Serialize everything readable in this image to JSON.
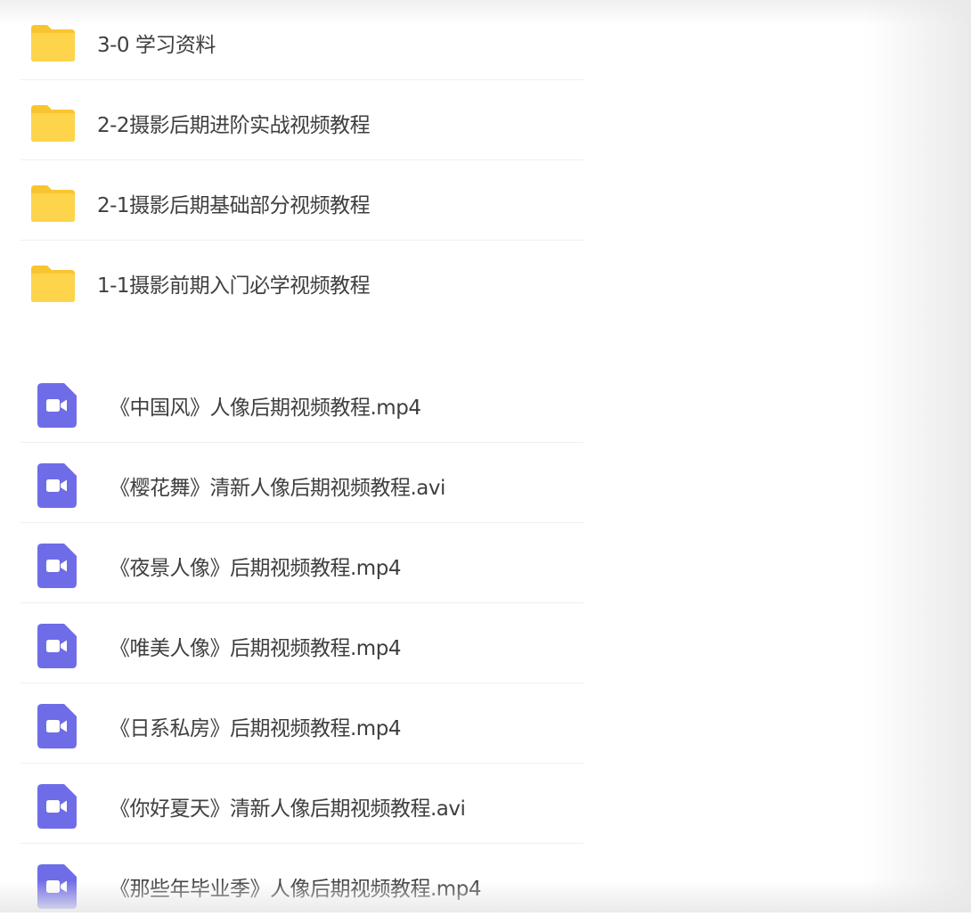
{
  "folders": [
    {
      "name": "3-0 学习资料",
      "icon": "folder-icon"
    },
    {
      "name": "2-2摄影后期进阶实战视频教程",
      "icon": "folder-icon"
    },
    {
      "name": "2-1摄影后期基础部分视频教程",
      "icon": "folder-icon"
    },
    {
      "name": "1-1摄影前期入门必学视频教程",
      "icon": "folder-icon"
    }
  ],
  "files": [
    {
      "name": "《中国风》人像后期视频教程.mp4",
      "icon": "video-file-icon"
    },
    {
      "name": "《樱花舞》清新人像后期视频教程.avi",
      "icon": "video-file-icon"
    },
    {
      "name": "《夜景人像》后期视频教程.mp4",
      "icon": "video-file-icon"
    },
    {
      "name": "《唯美人像》后期视频教程.mp4",
      "icon": "video-file-icon"
    },
    {
      "name": "《日系私房》后期视频教程.mp4",
      "icon": "video-file-icon"
    },
    {
      "name": "《你好夏天》清新人像后期视频教程.avi",
      "icon": "video-file-icon"
    },
    {
      "name": "《那些年毕业季》人像后期视频教程.mp4",
      "icon": "video-file-icon"
    }
  ],
  "colors": {
    "folder_fill": "#fcd34d",
    "folder_tab": "#f9c52f",
    "video_fill": "#6f6ce8",
    "text": "#3f3f3f",
    "divider": "#f0f0f0"
  }
}
